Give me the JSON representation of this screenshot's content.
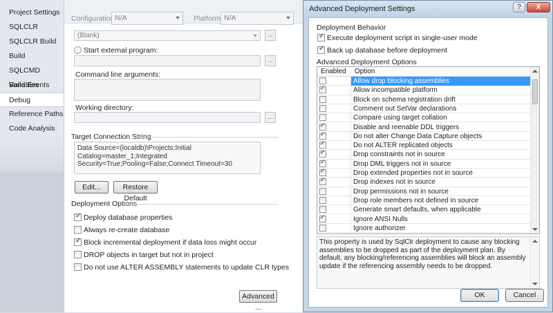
{
  "nav": {
    "items": [
      {
        "label": "Project Settings"
      },
      {
        "label": "SQLCLR"
      },
      {
        "label": "SQLCLR Build"
      },
      {
        "label": "Build"
      },
      {
        "label": "SQLCMD Variables"
      },
      {
        "label": "Build Events"
      },
      {
        "label": "Debug"
      },
      {
        "label": "Reference Paths"
      },
      {
        "label": "Code Analysis"
      }
    ],
    "selected": "Debug"
  },
  "config_bar": {
    "configuration_label": "Configuration:",
    "configuration_value": "N/A",
    "platform_label": "Platform:",
    "platform_value": "N/A"
  },
  "debug": {
    "blank_combo": "(Blank)",
    "start_external_program_label": "Start external program:",
    "command_line_args_label": "Command line arguments:",
    "working_dir_label": "Working directory:",
    "browse_label": "...",
    "target_connection_title": "Target Connection String",
    "connection_string": "Data Source=(localdb)\\Projects;Initial Catalog=master_1;Integrated Security=True;Pooling=False;Connect Timeout=30",
    "edit_button": "Edit...",
    "restore_default_button": "Restore Default",
    "deployment_options_title": "Deployment Options",
    "deployment_options": [
      {
        "label": "Deploy database properties",
        "checked": true
      },
      {
        "label": "Always re-create database",
        "checked": false
      },
      {
        "label": "Block incremental deployment if data loss might occur",
        "checked": true
      },
      {
        "label": "DROP objects in target but not in project",
        "checked": false
      },
      {
        "label": "Do not use ALTER ASSEMBLY statements to update CLR types",
        "checked": false
      }
    ],
    "advanced_button": "Advanced ..."
  },
  "dialog": {
    "title": "Advanced Deployment Settings",
    "help_button": "?",
    "close_button": "X",
    "behavior_title": "Deployment Behavior",
    "behaviors": [
      {
        "label": "Execute deployment script in single-user mode",
        "checked": true
      },
      {
        "label": "Back up database before deployment",
        "checked": true
      }
    ],
    "options_title": "Advanced Deployment Options",
    "grid_headers": {
      "enabled": "Enabled",
      "option": "Option"
    },
    "options": [
      {
        "label": "Allow drop blocking assemblies",
        "checked": false,
        "selected": true
      },
      {
        "label": "Allow incompatible platform",
        "checked": true
      },
      {
        "label": "Block on schema registration drift",
        "checked": false
      },
      {
        "label": "Comment out SetVar declarations",
        "checked": false
      },
      {
        "label": "Compare using target collation",
        "checked": false
      },
      {
        "label": "Disable and reenable DDL triggers",
        "checked": true
      },
      {
        "label": "Do not alter Change Data Capture objects",
        "checked": true
      },
      {
        "label": "Do not ALTER replicated objects",
        "checked": true
      },
      {
        "label": "Drop constraints not in source",
        "checked": true
      },
      {
        "label": "Drop DML triggers not in source",
        "checked": true
      },
      {
        "label": "Drop extended properties not in source",
        "checked": true
      },
      {
        "label": "Drop indexes not in source",
        "checked": true
      },
      {
        "label": "Drop permissions not in source",
        "checked": false
      },
      {
        "label": "Drop role members not defined in source",
        "checked": false
      },
      {
        "label": "Generate smart defaults, when applicable",
        "checked": false
      },
      {
        "label": "Ignore ANSI Nulls",
        "checked": true
      },
      {
        "label": "Ignore authorizer",
        "checked": false
      }
    ],
    "description": "This property is used by SqlClr deployment to cause any blocking assemblies to be dropped as part of the deployment plan. By default, any blocking/referencing assemblies will block an assembly update if the referencing assembly needs to be dropped.",
    "ok_button": "OK",
    "cancel_button": "Cancel"
  },
  "colors": {
    "selection": "#3399ff",
    "dialog_frame": "#c4d5e8",
    "close_red": "#c74a36"
  }
}
